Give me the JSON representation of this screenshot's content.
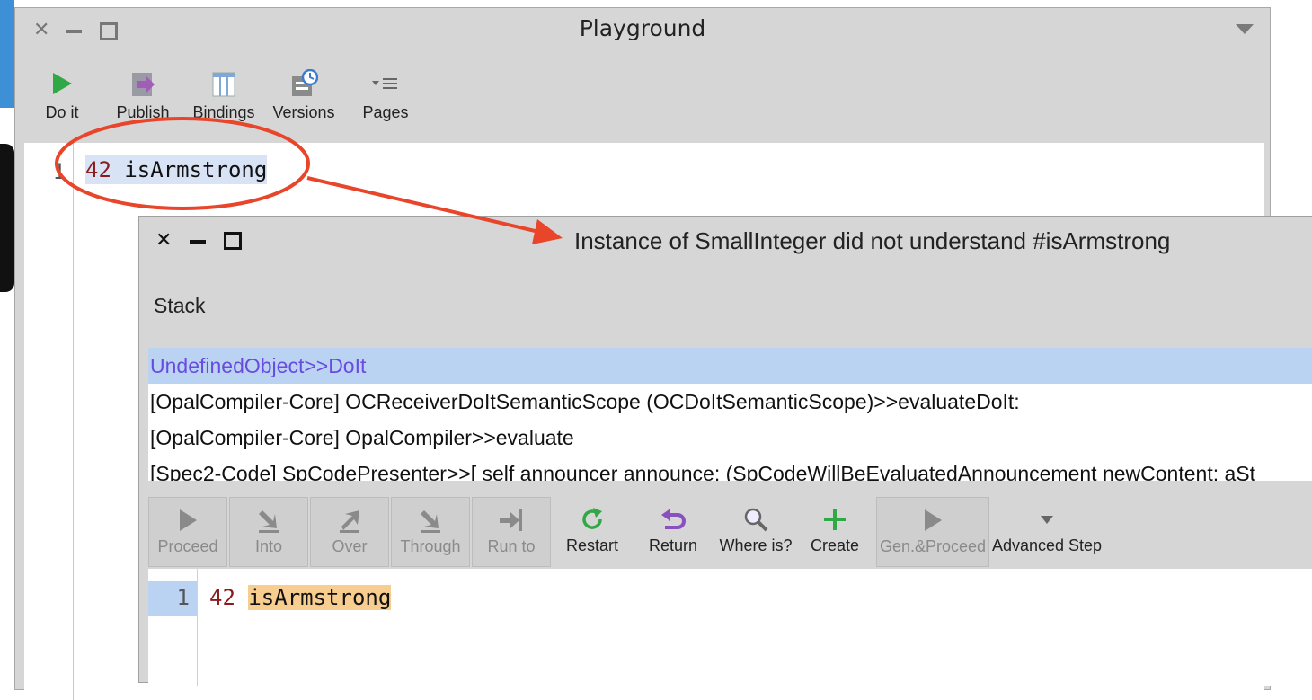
{
  "playground": {
    "title": "Playground",
    "toolbar": [
      {
        "label": "Do it",
        "icon": "play-icon"
      },
      {
        "label": "Publish",
        "icon": "publish-icon"
      },
      {
        "label": "Bindings",
        "icon": "bindings-icon"
      },
      {
        "label": "Versions",
        "icon": "versions-icon"
      },
      {
        "label": "Pages",
        "icon": "pages-icon"
      }
    ],
    "editor": {
      "line_number": "1",
      "code_number": "42",
      "code_selector": "isArmstrong"
    }
  },
  "debugger": {
    "title": "Instance of SmallInteger did not understand #isArmstrong",
    "stack_label": "Stack",
    "stack": [
      "UndefinedObject>>DoIt",
      "[OpalCompiler-Core] OCReceiverDoItSemanticScope (OCDoItSemanticScope)>>evaluateDoIt:",
      "[OpalCompiler-Core] OpalCompiler>>evaluate",
      "[Spec2-Code] SpCodePresenter>>[  self announcer announce: (SpCodeWillBeEvaluatedAnnouncement newContent: aSt"
    ],
    "toolbar": [
      {
        "label": "Proceed",
        "enabled": false
      },
      {
        "label": "Into",
        "enabled": false
      },
      {
        "label": "Over",
        "enabled": false
      },
      {
        "label": "Through",
        "enabled": false
      },
      {
        "label": "Run to",
        "enabled": false
      },
      {
        "label": "Restart",
        "enabled": true
      },
      {
        "label": "Return",
        "enabled": true
      },
      {
        "label": "Where is?",
        "enabled": true
      },
      {
        "label": "Create",
        "enabled": true
      },
      {
        "label": "Gen.&Proceed",
        "enabled": false
      },
      {
        "label": "Advanced Step",
        "enabled": true
      }
    ],
    "editor": {
      "line_number": "1",
      "code_number": "42",
      "code_selector": "isArmstrong"
    }
  },
  "colors": {
    "accent_selection": "#bad3f3",
    "annotation_red": "#e8452a",
    "highlight_word": "#f7ce8f"
  }
}
